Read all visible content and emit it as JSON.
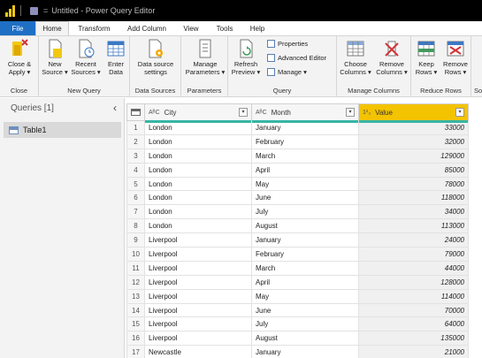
{
  "window": {
    "title": "Untitled - Power Query Editor"
  },
  "tabs": [
    "File",
    "Home",
    "Transform",
    "Add Column",
    "View",
    "Tools",
    "Help"
  ],
  "ribbon": {
    "close": {
      "btn1": [
        "Close &",
        "Apply ▾"
      ],
      "label": "Close"
    },
    "new_query": {
      "new": [
        "New",
        "Source ▾"
      ],
      "recent": [
        "Recent",
        "Sources ▾"
      ],
      "enter": [
        "Enter",
        "Data"
      ],
      "label": "New Query"
    },
    "data_sources": {
      "btn": [
        "Data source",
        "settings"
      ],
      "label": "Data Sources"
    },
    "parameters": {
      "btn": [
        "Manage",
        "Parameters ▾"
      ],
      "label": "Parameters"
    },
    "query": {
      "refresh": [
        "Refresh",
        "Preview ▾"
      ],
      "properties": "Properties",
      "advanced": "Advanced Editor",
      "manage": "Manage ▾",
      "label": "Query"
    },
    "manage_columns": {
      "choose": [
        "Choose",
        "Columns ▾"
      ],
      "remove": [
        "Remove",
        "Columns ▾"
      ],
      "label": "Manage Columns"
    },
    "reduce_rows": {
      "keep": [
        "Keep",
        "Rows ▾"
      ],
      "remove": [
        "Remove",
        "Rows ▾"
      ],
      "label": "Reduce Rows"
    },
    "cut_label": "So"
  },
  "queries": {
    "header": "Queries [1]",
    "items": [
      "Table1"
    ]
  },
  "grid": {
    "columns": [
      {
        "type": "AᴮC",
        "name": "City"
      },
      {
        "type": "AᴮC",
        "name": "Month"
      },
      {
        "type": "1²₃",
        "name": "Value"
      }
    ],
    "rows": [
      [
        "1",
        "London",
        "January",
        "33000"
      ],
      [
        "2",
        "London",
        "February",
        "32000"
      ],
      [
        "3",
        "London",
        "March",
        "129000"
      ],
      [
        "4",
        "London",
        "April",
        "85000"
      ],
      [
        "5",
        "London",
        "May",
        "78000"
      ],
      [
        "6",
        "London",
        "June",
        "118000"
      ],
      [
        "7",
        "London",
        "July",
        "34000"
      ],
      [
        "8",
        "London",
        "August",
        "113000"
      ],
      [
        "9",
        "Liverpool",
        "January",
        "24000"
      ],
      [
        "10",
        "Liverpool",
        "February",
        "79000"
      ],
      [
        "11",
        "Liverpool",
        "March",
        "44000"
      ],
      [
        "12",
        "Liverpool",
        "April",
        "128000"
      ],
      [
        "13",
        "Liverpool",
        "May",
        "114000"
      ],
      [
        "14",
        "Liverpool",
        "June",
        "70000"
      ],
      [
        "15",
        "Liverpool",
        "July",
        "64000"
      ],
      [
        "16",
        "Liverpool",
        "August",
        "135000"
      ],
      [
        "17",
        "Newcastle",
        "January",
        "21000"
      ]
    ]
  }
}
